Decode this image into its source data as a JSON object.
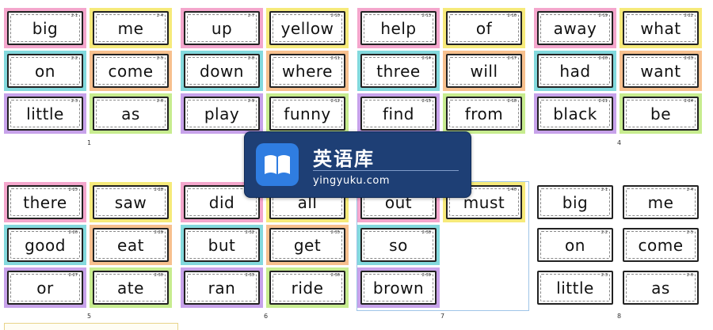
{
  "colors": {
    "pink": "#f4a6cc",
    "yellow": "#f6ea7a",
    "cyan": "#83d9dd",
    "orange": "#f7c08e",
    "purple": "#c7a2ea",
    "green": "#c7ec8f",
    "white": "#ffffff"
  },
  "pages": [
    {
      "number": "1",
      "cards": [
        {
          "word": "big",
          "code": "2-1"
        },
        {
          "word": "me",
          "code": "2-4"
        },
        {
          "word": "on",
          "code": "2-2"
        },
        {
          "word": "come",
          "code": "2-5"
        },
        {
          "word": "little",
          "code": "2-3"
        },
        {
          "word": "as",
          "code": "2-6"
        }
      ]
    },
    {
      "number": "",
      "cards": [
        {
          "word": "up",
          "code": "2-7"
        },
        {
          "word": "yellow",
          "code": "2-10"
        },
        {
          "word": "down",
          "code": "2-8"
        },
        {
          "word": "where",
          "code": "2-11"
        },
        {
          "word": "play",
          "code": "2-9"
        },
        {
          "word": "funny",
          "code": "2-12"
        }
      ]
    },
    {
      "number": "",
      "cards": [
        {
          "word": "help",
          "code": "2-13"
        },
        {
          "word": "of",
          "code": "2-16"
        },
        {
          "word": "three",
          "code": "2-14"
        },
        {
          "word": "will",
          "code": "2-17"
        },
        {
          "word": "find",
          "code": "2-15"
        },
        {
          "word": "from",
          "code": "2-18"
        }
      ]
    },
    {
      "number": "4",
      "cards": [
        {
          "word": "away",
          "code": "2-19"
        },
        {
          "word": "what",
          "code": "2-22"
        },
        {
          "word": "had",
          "code": "2-20"
        },
        {
          "word": "want",
          "code": "2-23"
        },
        {
          "word": "black",
          "code": "2-21"
        },
        {
          "word": "be",
          "code": "2-24"
        }
      ]
    },
    {
      "number": "5",
      "cards": [
        {
          "word": "there",
          "code": "2-25"
        },
        {
          "word": "saw",
          "code": "2-28"
        },
        {
          "word": "good",
          "code": "2-26"
        },
        {
          "word": "eat",
          "code": "2-29"
        },
        {
          "word": "or",
          "code": "2-27"
        },
        {
          "word": "ate",
          "code": "2-30"
        }
      ]
    },
    {
      "number": "6",
      "cards": [
        {
          "word": "did",
          "code": "2-31"
        },
        {
          "word": "all",
          "code": "2-34"
        },
        {
          "word": "but",
          "code": "2-32"
        },
        {
          "word": "get",
          "code": "2-35"
        },
        {
          "word": "ran",
          "code": "2-33"
        },
        {
          "word": "ride",
          "code": "2-36"
        }
      ]
    },
    {
      "number": "7",
      "cards": [
        {
          "word": "out",
          "code": "2-37"
        },
        {
          "word": "must",
          "code": "1-40"
        },
        {
          "word": "so",
          "code": "2-38"
        },
        {
          "word": "",
          "code": ""
        },
        {
          "word": "brown",
          "code": "2-39"
        },
        {
          "word": "",
          "code": ""
        }
      ]
    },
    {
      "number": "8",
      "cards": [
        {
          "word": "big",
          "code": "2-1"
        },
        {
          "word": "me",
          "code": "2-4"
        },
        {
          "word": "on",
          "code": "2-2"
        },
        {
          "word": "come",
          "code": "2-5"
        },
        {
          "word": "little",
          "code": "2-3"
        },
        {
          "word": "as",
          "code": "2-6"
        }
      ]
    }
  ],
  "watermark": {
    "title": "英语库",
    "url": "yingyuku.com",
    "icon": "book-icon"
  }
}
